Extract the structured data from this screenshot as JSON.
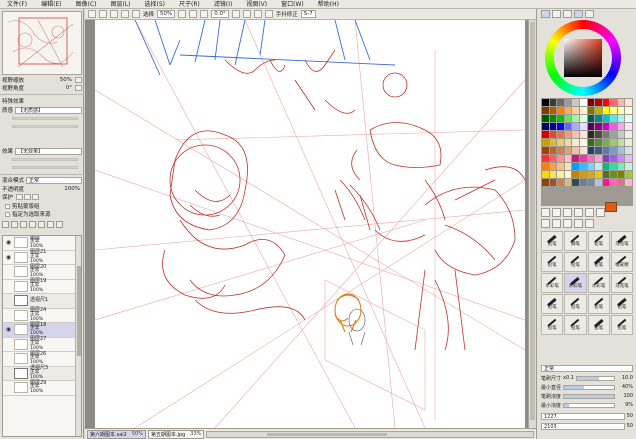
{
  "menu": [
    "文件(F)",
    "编辑(E)",
    "图像(C)",
    "图层(L)",
    "选择(S)",
    "尺子(R)",
    "滤镜(I)",
    "视图(V)",
    "窗口(W)",
    "帮助(H)"
  ],
  "toolbar": {
    "select_label": "选择",
    "zoom": "50%",
    "angle": "0.0°",
    "stabilizer_label": "手抖修正",
    "stabilizer_value": "S-7"
  },
  "navigator": {
    "zoom_label": "视野缩放",
    "zoom_value": "50%",
    "angle_label": "视野角度",
    "angle_value": "0°"
  },
  "texture": {
    "heading": "特殊效果",
    "paper_label": "质感",
    "paper_value": "【无质感】",
    "effect_label": "效果",
    "effect_value": "【无效果】"
  },
  "layer_props": {
    "blend_label": "混合模式",
    "blend_value": "正常",
    "opacity_label": "不透明度",
    "opacity_value": "100%",
    "protect_label": "保护",
    "clip_label": "剪贴蒙版组",
    "select_src_label": "指定为选取来源"
  },
  "layers": [
    {
      "name": "图层",
      "mode": "正常",
      "opacity": "100%",
      "selected": false,
      "folder": false
    },
    {
      "name": "图层21",
      "mode": "正常",
      "opacity": "100%",
      "selected": false,
      "folder": false
    },
    {
      "name": "图层20",
      "mode": "正常",
      "opacity": "100%",
      "selected": false,
      "folder": false
    },
    {
      "name": "图层19",
      "mode": "正常",
      "opacity": "100%",
      "selected": false,
      "folder": false
    },
    {
      "name": "透视尺1",
      "mode": "",
      "opacity": "",
      "selected": false,
      "folder": true
    },
    {
      "name": "图层24",
      "mode": "正常",
      "opacity": "100%",
      "selected": false,
      "folder": false
    },
    {
      "name": "图层18",
      "mode": "正常",
      "opacity": "100%",
      "selected": true,
      "folder": false
    },
    {
      "name": "图层27",
      "mode": "正常",
      "opacity": "100%",
      "selected": false,
      "folder": false
    },
    {
      "name": "图层26",
      "mode": "正常",
      "opacity": "100%",
      "selected": false,
      "folder": false
    },
    {
      "name": "透视尺3",
      "mode": "正常",
      "opacity": "100%",
      "selected": false,
      "folder": true
    },
    {
      "name": "图层29",
      "mode": "正常",
      "opacity": "100%",
      "selected": false,
      "folder": false
    }
  ],
  "files": [
    {
      "name": "第六期图本.sai2",
      "zoom": "50%",
      "active": true
    },
    {
      "name": "第五期图本.jpg",
      "zoom": "33%",
      "active": false
    }
  ],
  "colors": {
    "current": "#e25a13",
    "swatches": [
      "#000000",
      "#3a3a3a",
      "#6b6b6b",
      "#9a9a9a",
      "#c7c7c7",
      "#ffffff",
      "#7a0000",
      "#b40000",
      "#ff0000",
      "#ff6a6a",
      "#ffb4b4",
      "#ffe0e0",
      "#7a3d00",
      "#b45a00",
      "#ff8000",
      "#ffaa55",
      "#ffd0a0",
      "#fff0e0",
      "#7a7a00",
      "#b4b400",
      "#ffff00",
      "#ffff7a",
      "#ffffb4",
      "#ffffe0",
      "#005a00",
      "#008c00",
      "#00c800",
      "#66e066",
      "#aaf0aa",
      "#e0ffe0",
      "#005a5a",
      "#008c8c",
      "#00c8c8",
      "#66e0e0",
      "#aaf0f0",
      "#e0ffff",
      "#00005a",
      "#00008c",
      "#0000ff",
      "#6666ff",
      "#aaaaff",
      "#e0e0ff",
      "#5a005a",
      "#8c008c",
      "#c800c8",
      "#e066e0",
      "#f0aaf0",
      "#ffe0ff",
      "#d20000",
      "#e04a2a",
      "#e87050",
      "#f09a80",
      "#f6c2b2",
      "#fbe3da",
      "#2a2a2a",
      "#4a4a4a",
      "#7a7a7a",
      "#a0a0a0",
      "#c8c8c8",
      "#eeeeee",
      "#c8a000",
      "#dcb840",
      "#e8cc70",
      "#f0dc9a",
      "#f6ead0",
      "#fbf6ea",
      "#3a6a20",
      "#5a8c3a",
      "#7aac5a",
      "#9cc87a",
      "#c0e0a6",
      "#e2f2d6",
      "#a04010",
      "#c06030",
      "#d08050",
      "#e0a07a",
      "#ecc2a6",
      "#f6e2d2",
      "#20406a",
      "#3a5a8c",
      "#5a7aac",
      "#7a9cc8",
      "#a6c0e0",
      "#d2e2f2",
      "#ff3030",
      "#ff6060",
      "#ff9090",
      "#ffc0c0",
      "#c02080",
      "#e040a0",
      "#f070c0",
      "#f8a0d8",
      "#8040c0",
      "#a060e0",
      "#c090f0",
      "#e0c0f8",
      "#ff7f00",
      "#ff9f3f",
      "#ffbf7f",
      "#ffdfbf",
      "#00a0ff",
      "#40b8ff",
      "#80d0ff",
      "#c0e8ff",
      "#00c080",
      "#40d8a0",
      "#80e8c0",
      "#c0f4e0",
      "#ffd700",
      "#ffe34d",
      "#ffee99",
      "#fff7cc",
      "#b8860b",
      "#cd9b1d",
      "#daa520",
      "#eec900",
      "#556b2f",
      "#6b8e23",
      "#808000",
      "#9acd32",
      "#8b4513",
      "#a0522d",
      "#cd853f",
      "#deb887",
      "#2f4f4f",
      "#708090",
      "#778899",
      "#b0c4de",
      "#ff1493",
      "#ff69b4",
      "#db7093",
      "#ffb6c1"
    ]
  },
  "brushes": [
    {
      "name": "铅笔",
      "sub": "喷枪"
    },
    {
      "name": "钢笔",
      "sub": ""
    },
    {
      "name": "铅笔",
      "sub": ""
    },
    {
      "name": "马克笔",
      "sub": ""
    },
    {
      "name": "铅笔",
      "sub": ""
    },
    {
      "name": "铅笔",
      "sub": ""
    },
    {
      "name": "铅笔",
      "sub": ""
    },
    {
      "name": "橡皮擦",
      "sub": ""
    },
    {
      "name": "水彩笔",
      "sub": ""
    },
    {
      "name": "水彩笔",
      "sub": ""
    },
    {
      "name": "水彩笔",
      "sub": ""
    },
    {
      "name": "马克笔",
      "sub": ""
    },
    {
      "name": "铅笔",
      "sub": ""
    },
    {
      "name": "铅笔",
      "sub": ""
    },
    {
      "name": "铅笔",
      "sub": ""
    },
    {
      "name": "铅笔",
      "sub": ""
    },
    {
      "name": "铅笔",
      "sub": ""
    },
    {
      "name": "铅笔",
      "sub": ""
    },
    {
      "name": "铅笔",
      "sub": ""
    },
    {
      "name": "铅笔",
      "sub": ""
    }
  ],
  "brush_props": {
    "blend_label": "正常",
    "size_label": "笔刷尺寸",
    "size_value": "10.0",
    "size_mult": "x0.1",
    "min_size_label": "最小直径",
    "min_size_value": "40%",
    "density_label": "笔刷浓度",
    "density_value": "100",
    "min_density_label": "最小浓度",
    "min_density_value": "9%",
    "shape_label": "1227",
    "shape_value": "50",
    "tex_label": "2103",
    "tex_value": "50"
  }
}
